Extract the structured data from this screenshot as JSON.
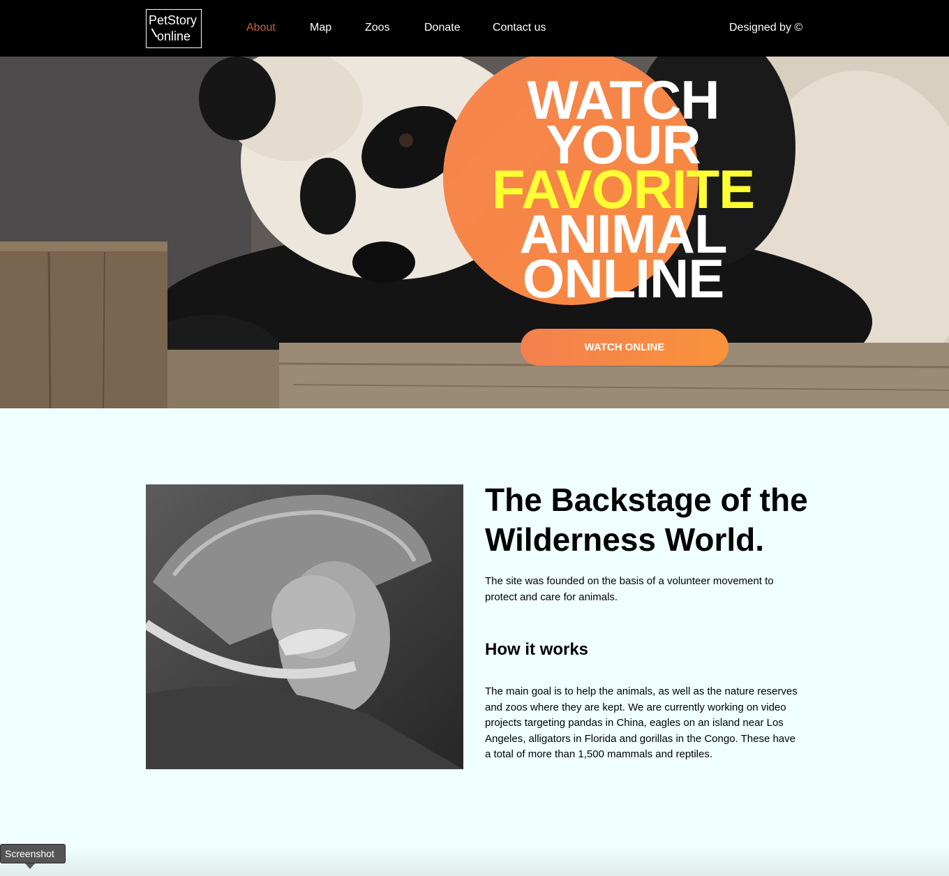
{
  "header": {
    "logo_line1": "PetStory",
    "logo_line2": "online",
    "nav": [
      {
        "label": "About",
        "active": true
      },
      {
        "label": "Map",
        "active": false
      },
      {
        "label": "Zoos",
        "active": false
      },
      {
        "label": "Donate",
        "active": false
      },
      {
        "label": "Contact us",
        "active": false
      }
    ],
    "designed_by": "Designed by ©"
  },
  "hero": {
    "title_lines": [
      "WATCH",
      "YOUR",
      "FAVORITE",
      "ANIMAL",
      "ONLINE"
    ],
    "button_label": "WATCH ONLINE",
    "colors": {
      "accent": "#f8893f",
      "highlight": "#ffff33"
    }
  },
  "about": {
    "title": "The Backstage of the Wilderness World.",
    "intro": "The site was founded on the basis of a volunteer movement to protect and care for animals.",
    "how_title": "How it works",
    "how_text": "The main goal is to help the animals, as well as the nature reserves and zoos where they are kept. We are currently working on video projects targeting pandas in China, eagles on an island near Los Angeles, alligators in Florida and gorillas in the Congo. These have a total of more than 1,500 mammals and reptiles."
  },
  "tooltip": {
    "label": "Screenshot"
  }
}
